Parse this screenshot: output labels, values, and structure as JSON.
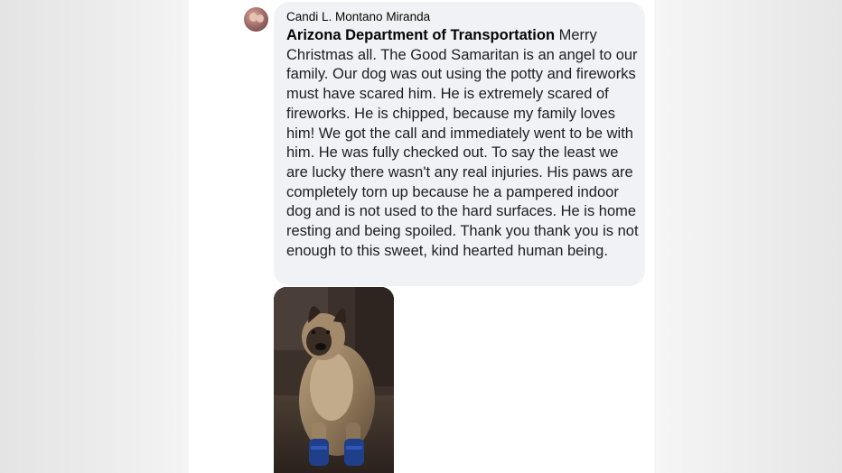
{
  "comment": {
    "author": "Candi L. Montano Miranda",
    "mention": "Arizona Department of Transportation",
    "text": " Merry Christmas all. The Good Samaritan is an angel to our family. Our dog was out using the potty and fireworks must have scared him. He is extremely scared of fireworks. He is chipped, because my family loves him! We got the call and immediately went to be with him. He was fully checked out. To say the least we are lucky there wasn't any real injuries. His paws are completely torn up because he a pampered indoor dog and is not used to the hard surfaces. He is home resting and being spoiled. Thank you thank you is not enough to this sweet, kind hearted human being.",
    "avatar_icon": "profile-avatar",
    "photo_icon": "dog-photo"
  }
}
